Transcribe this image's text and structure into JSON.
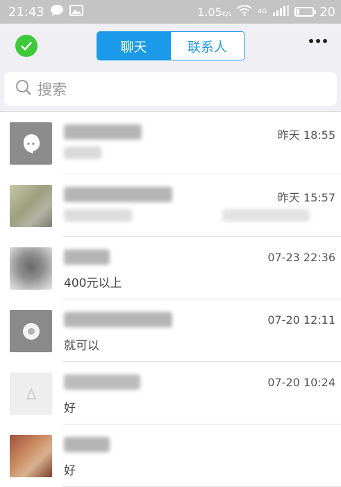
{
  "status_bar": {
    "time": "21:43",
    "net_speed": "1.05",
    "net_speed_unit": "K/s",
    "network_type": "4G",
    "battery": "20"
  },
  "header": {
    "tabs": [
      {
        "label": "聊天",
        "active": true
      },
      {
        "label": "联系人",
        "active": false
      }
    ]
  },
  "search": {
    "placeholder": "搜索"
  },
  "conversations": [
    {
      "time": "昨天 18:55",
      "preview": ""
    },
    {
      "time": "昨天 15:57",
      "preview": ""
    },
    {
      "time": "07-23 22:36",
      "preview": "400元以上"
    },
    {
      "time": "07-20 12:11",
      "preview": "就可以"
    },
    {
      "time": "07-20 10:24",
      "preview": "好"
    },
    {
      "time": "",
      "preview": "好"
    }
  ],
  "colors": {
    "accent": "#1a9ae8",
    "check_green": "#3ec93a",
    "header_bg": "#efeff4",
    "status_bar_bg": "#c4c4c4"
  }
}
